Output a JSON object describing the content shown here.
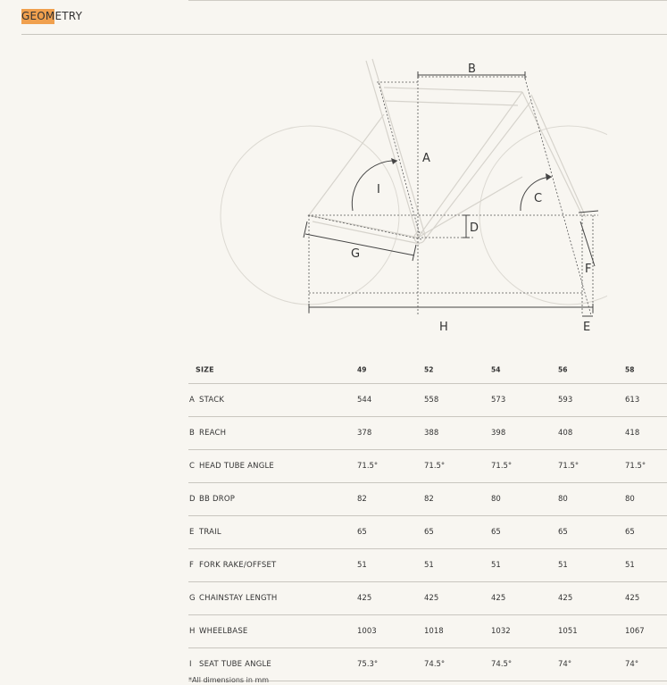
{
  "title": {
    "highlight": "GEOM",
    "rest": "ETRY"
  },
  "diagram": {
    "labels": {
      "A": "A",
      "B": "B",
      "C": "C",
      "D": "D",
      "E": "E",
      "F": "F",
      "G": "G",
      "H": "H",
      "I": "I"
    }
  },
  "table": {
    "header": {
      "param": "SIZE",
      "sizes": [
        "49",
        "52",
        "54",
        "56",
        "58"
      ]
    },
    "rows": [
      {
        "letter": "A",
        "param": "STACK",
        "values": [
          "544",
          "558",
          "573",
          "593",
          "613"
        ]
      },
      {
        "letter": "B",
        "param": "REACH",
        "values": [
          "378",
          "388",
          "398",
          "408",
          "418"
        ]
      },
      {
        "letter": "C",
        "param": "HEAD TUBE ANGLE",
        "values": [
          "71.5°",
          "71.5°",
          "71.5°",
          "71.5°",
          "71.5°"
        ]
      },
      {
        "letter": "D",
        "param": "BB DROP",
        "values": [
          "82",
          "82",
          "80",
          "80",
          "80"
        ]
      },
      {
        "letter": "E",
        "param": "TRAIL",
        "values": [
          "65",
          "65",
          "65",
          "65",
          "65"
        ]
      },
      {
        "letter": "F",
        "param": "FORK RAKE/OFFSET",
        "values": [
          "51",
          "51",
          "51",
          "51",
          "51"
        ]
      },
      {
        "letter": "G",
        "param": "CHAINSTAY LENGTH",
        "values": [
          "425",
          "425",
          "425",
          "425",
          "425"
        ]
      },
      {
        "letter": "H",
        "param": "WHEELBASE",
        "values": [
          "1003",
          "1018",
          "1032",
          "1051",
          "1067"
        ]
      },
      {
        "letter": "I",
        "param": "SEAT TUBE ANGLE",
        "values": [
          "75.3°",
          "74.5°",
          "74.5°",
          "74°",
          "74°"
        ]
      }
    ]
  },
  "footnote": "*All dimensions in mm"
}
